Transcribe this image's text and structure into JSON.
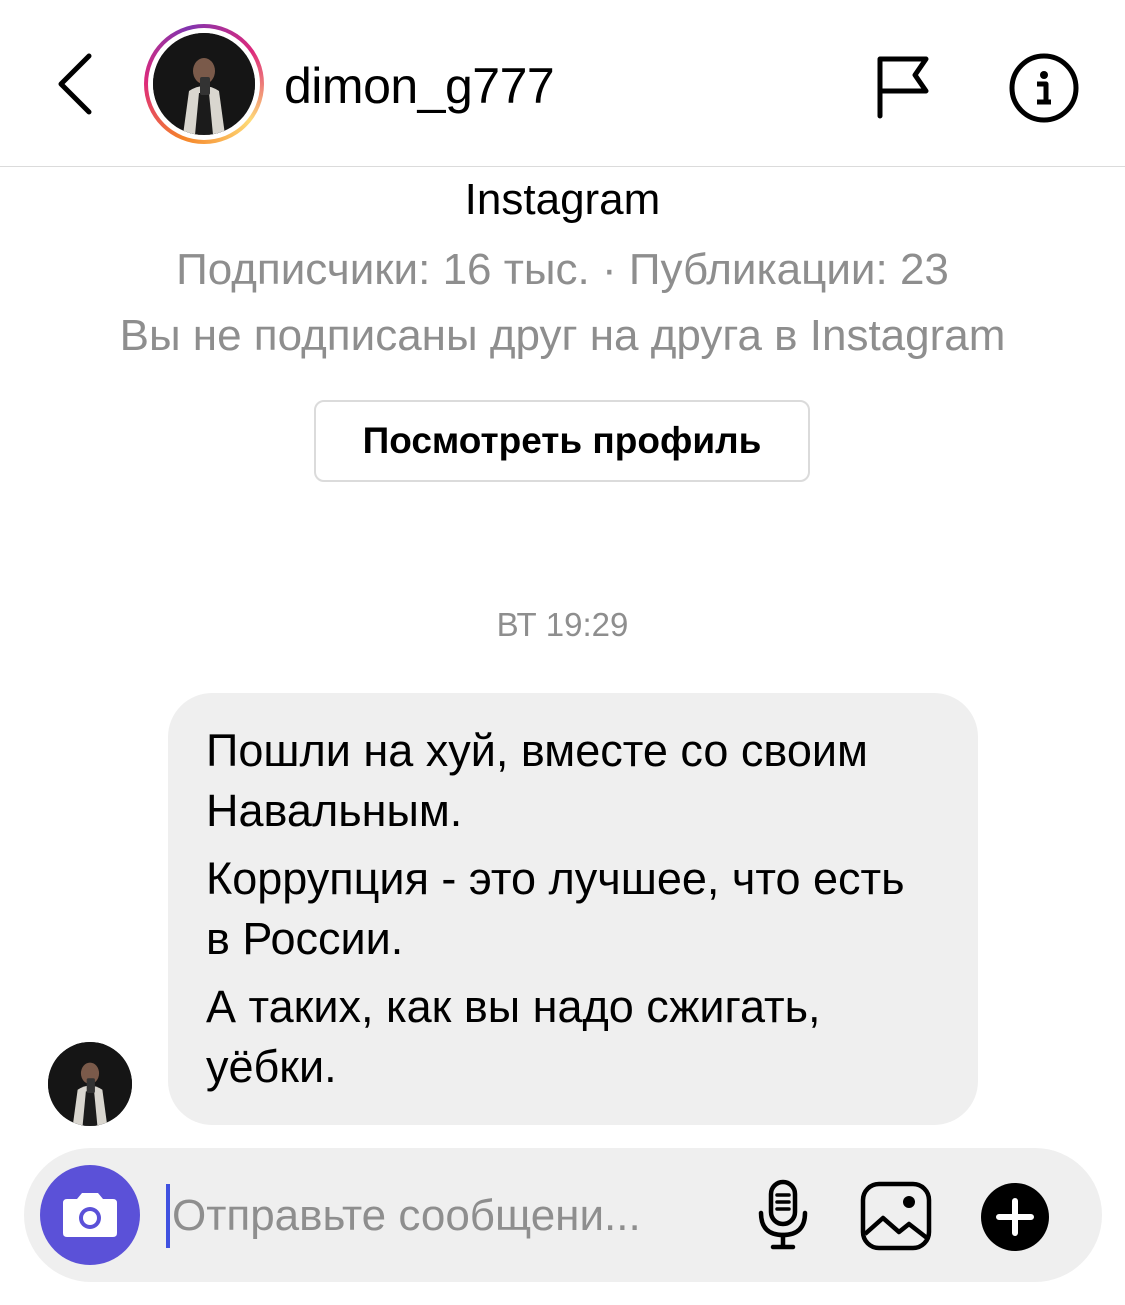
{
  "header": {
    "username": "dimon_g777",
    "back_icon": "chevron-left-icon",
    "flag_icon": "flag-icon",
    "info_icon": "info-icon"
  },
  "profile": {
    "name": "Instagram",
    "stats": "Подписчики: 16 тыс. · Публикации: 23",
    "follow_status": "Вы не подписаны друг на друга в Instagram",
    "view_profile_label": "Посмотреть профиль"
  },
  "chat": {
    "timestamp": "ВТ 19:29",
    "messages": [
      {
        "paragraphs": [
          "Пошли на хуй, вместе со своим Навальным.",
          "Коррупция - это лучшее, что есть в России.",
          "А таких, как вы надо сжигать, уёбки."
        ]
      }
    ]
  },
  "composer": {
    "placeholder": "Отправьте сообщени...",
    "value": "",
    "camera_icon": "camera-icon",
    "mic_icon": "microphone-icon",
    "gallery_icon": "image-icon",
    "plus_icon": "plus-circle-icon"
  },
  "colors": {
    "accent": "#5b51d8",
    "muted_text": "#8e8e8e",
    "bubble_bg": "#efefef",
    "border": "#dbdbdb"
  }
}
